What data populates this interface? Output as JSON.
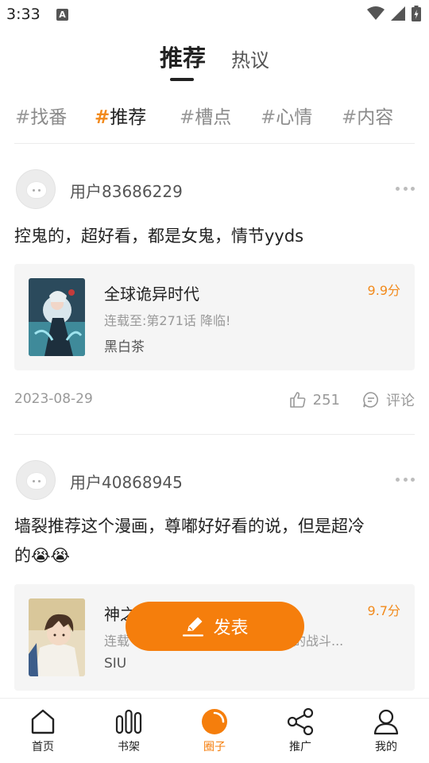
{
  "status_bar": {
    "time": "3:33",
    "notification_letter": "A"
  },
  "top_tabs": [
    {
      "label": "推荐",
      "active": true
    },
    {
      "label": "热议",
      "active": false
    }
  ],
  "hashtags": [
    {
      "label": "找番",
      "active": false
    },
    {
      "label": "推荐",
      "active": true
    },
    {
      "label": "槽点",
      "active": false
    },
    {
      "label": "心情",
      "active": false
    },
    {
      "label": "内容",
      "active": false
    }
  ],
  "posts": [
    {
      "username": "用户83686229",
      "text_lines": [
        "控鬼的，超好看，都是女鬼，情节yyds"
      ],
      "book": {
        "title": "全球诡异时代",
        "subtitle": "连载至:第271话 降临!",
        "author": "黑白茶",
        "score": "9.9分"
      },
      "date": "2023-08-29",
      "likes": "251",
      "comment_label": "评论"
    },
    {
      "username": "用户40868945",
      "text_lines": [
        "墙裂推荐这个漫画，尊嘟好好看的说，但是超冷",
        "的😭😭"
      ],
      "book": {
        "title": "神之",
        "subtitle": "连载",
        "subtitle_tail": "的战斗...",
        "author": "SIU",
        "score": "9.7分"
      }
    }
  ],
  "publish_button": {
    "label": "发表"
  },
  "bottom_nav": [
    {
      "label": "首页",
      "icon": "home-icon",
      "active": false
    },
    {
      "label": "书架",
      "icon": "bookshelf-icon",
      "active": false
    },
    {
      "label": "圈子",
      "icon": "circle-icon",
      "active": true
    },
    {
      "label": "推广",
      "icon": "share-icon",
      "active": false
    },
    {
      "label": "我的",
      "icon": "profile-icon",
      "active": false
    }
  ],
  "colors": {
    "accent": "#f57e0c",
    "score": "#f28a1c",
    "text": "#222222",
    "muted": "#999999"
  }
}
